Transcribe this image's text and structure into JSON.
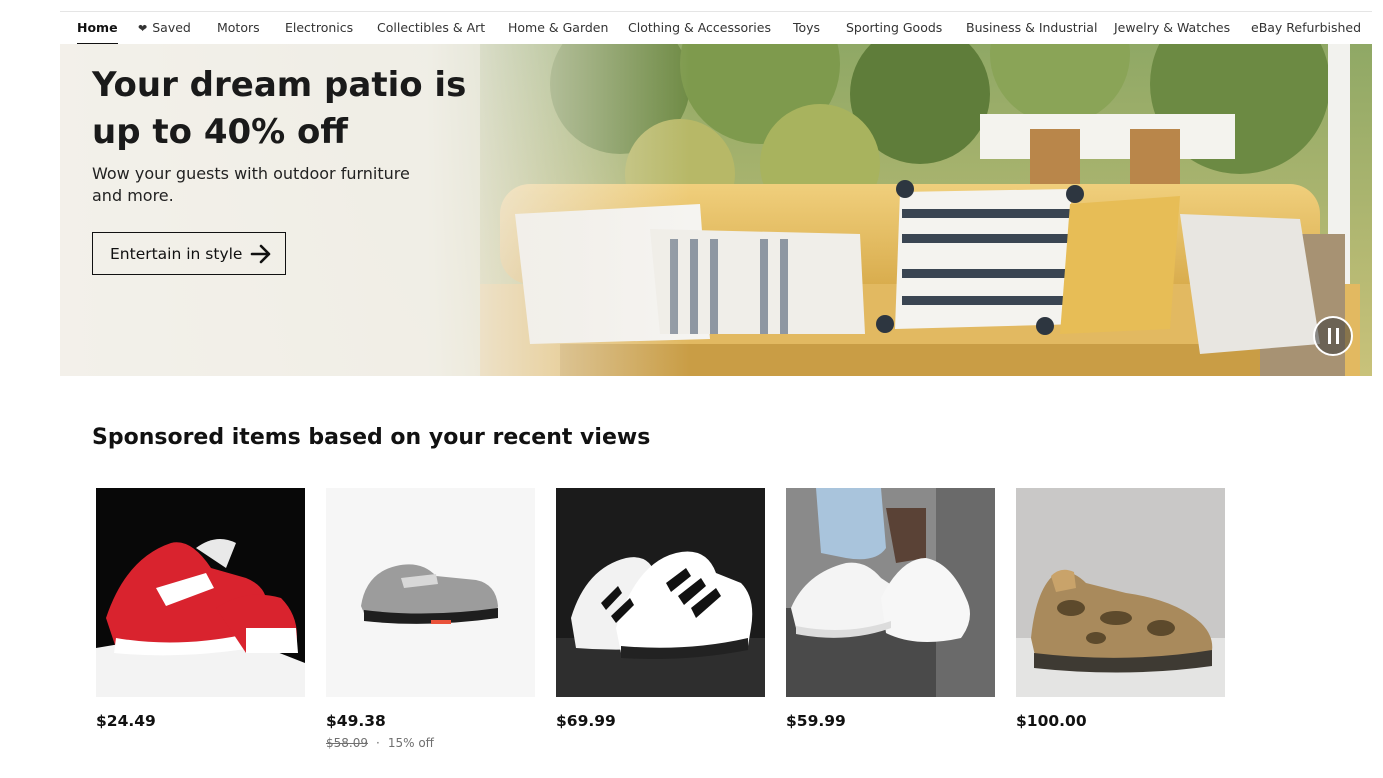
{
  "nav": {
    "items": [
      {
        "label": "Home"
      },
      {
        "label": "Saved"
      },
      {
        "label": "Motors"
      },
      {
        "label": "Electronics"
      },
      {
        "label": "Collectibles & Art"
      },
      {
        "label": "Home & Garden"
      },
      {
        "label": "Clothing & Accessories"
      },
      {
        "label": "Toys"
      },
      {
        "label": "Sporting Goods"
      },
      {
        "label": "Business & Industrial"
      },
      {
        "label": "Jewelry & Watches"
      },
      {
        "label": "eBay Refurbished"
      }
    ],
    "active": "Home"
  },
  "hero": {
    "title": "Your dream patio is up to 40% off",
    "subtitle": "Wow your guests with outdoor furniture and more.",
    "cta_label": "Entertain in style"
  },
  "sponsored": {
    "title": "Sponsored items based on your recent views",
    "items": [
      {
        "price": "$24.49",
        "image": "red-white-sneaker"
      },
      {
        "price": "$49.38",
        "original_price": "$58.09",
        "discount": "15% off",
        "image": "grey-running-sneaker"
      },
      {
        "price": "$69.99",
        "image": "white-black-striped-sneaker"
      },
      {
        "price": "$59.99",
        "image": "white-sneakers-on-feet"
      },
      {
        "price": "$100.00",
        "image": "camo-hiking-sneaker"
      }
    ]
  },
  "colors": {
    "text": "#111111",
    "muted": "#707070",
    "hero_sofa": "#e8c46a"
  }
}
